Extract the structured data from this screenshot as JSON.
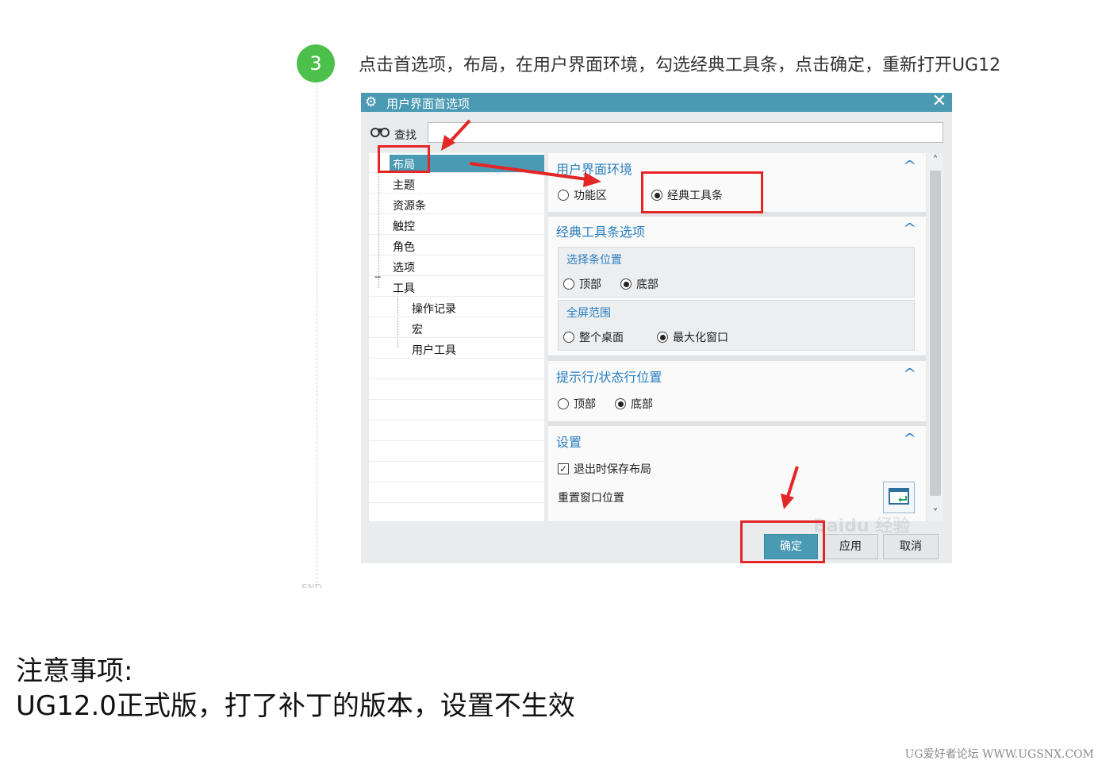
{
  "step": {
    "number": "3",
    "instruction": "点击首选项，布局，在用户界面环境，勾选经典工具条，点击确定，重新打开UG12",
    "end_mark": "END"
  },
  "dialog": {
    "title": "用户界面首选项",
    "close_icon": "close-icon",
    "find_label": "查找",
    "find_value": "",
    "tree": [
      {
        "label": "布局",
        "selected": true
      },
      {
        "label": "主题"
      },
      {
        "label": "资源条"
      },
      {
        "label": "触控"
      },
      {
        "label": "角色"
      },
      {
        "label": "选项"
      },
      {
        "label": "工具",
        "expanded": true
      },
      {
        "label": "操作记录",
        "child": true
      },
      {
        "label": "宏",
        "child": true
      },
      {
        "label": "用户工具",
        "child": true
      }
    ],
    "sections": {
      "ui_env": {
        "title": "用户界面环境",
        "option_ribbon": "功能区",
        "option_classic": "经典工具条",
        "selected": "经典工具条"
      },
      "classic_opts": {
        "title": "经典工具条选项",
        "bar_pos_title": "选择条位置",
        "bar_top": "顶部",
        "bar_bottom": "底部",
        "bar_selected": "底部",
        "fullscreen_title": "全屏范围",
        "fs_desktop": "整个桌面",
        "fs_maximized": "最大化窗口",
        "fs_selected": "最大化窗口"
      },
      "cue_line": {
        "title": "提示行/状态行位置",
        "top": "顶部",
        "bottom": "底部",
        "selected": "底部"
      },
      "settings": {
        "title": "设置",
        "save_layout": "退出时保存布局",
        "save_layout_checked": true,
        "reset_window": "重置窗口位置"
      }
    },
    "buttons": {
      "ok": "确定",
      "apply": "应用",
      "cancel": "取消"
    },
    "watermark": "Baidu 经验"
  },
  "notes": {
    "title": "注意事项:",
    "body": "UG12.0正式版，打了补丁的版本，设置不生效"
  },
  "footer": "UG爱好者论坛 WWW.UGSNX.COM",
  "colors": {
    "accent": "#4a9ab4",
    "step_green": "#4cc04a",
    "annotation_red": "#e32626",
    "section_title_blue": "#2a7fbf"
  }
}
